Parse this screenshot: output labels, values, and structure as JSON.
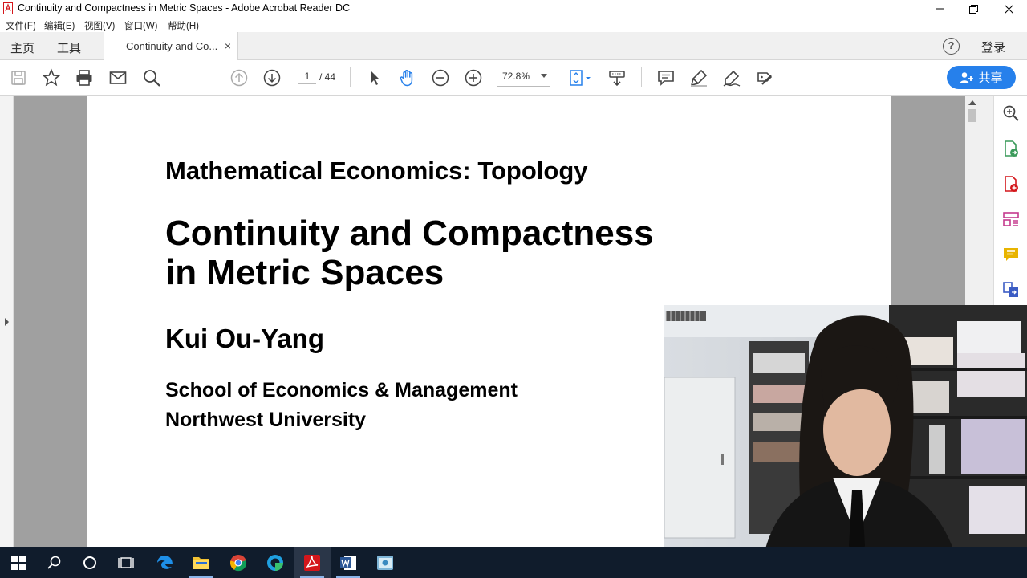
{
  "window": {
    "title": "Continuity and Compactness in Metric Spaces - Adobe Acrobat Reader DC"
  },
  "menu": [
    "文件(F)",
    "编辑(E)",
    "视图(V)",
    "窗口(W)",
    "帮助(H)"
  ],
  "tabs": {
    "home": "主页",
    "tools": "工具",
    "document": "Continuity and Co...",
    "close": "×"
  },
  "header": {
    "help": "?",
    "login": "登录"
  },
  "toolbar": {
    "page_current": "1",
    "page_total": "/ 44",
    "zoom": "72.8%",
    "share": "共享"
  },
  "document_page": {
    "course": "Mathematical Economics: Topology",
    "title_line1": "Continuity and Compactness",
    "title_line2": "in Metric Spaces",
    "author": "Kui Ou-Yang",
    "affiliation_line1": "School of Economics & Management",
    "affiliation_line2": "Northwest University"
  },
  "colors": {
    "accent": "#2680eb",
    "taskbar": "#101c2c",
    "acrobat_red": "#d4161b"
  },
  "taskbar_apps": [
    "windows-start",
    "search",
    "cortana",
    "task-view",
    "edge",
    "file-explorer",
    "chrome",
    "edge-alt",
    "acrobat",
    "word",
    "app"
  ]
}
